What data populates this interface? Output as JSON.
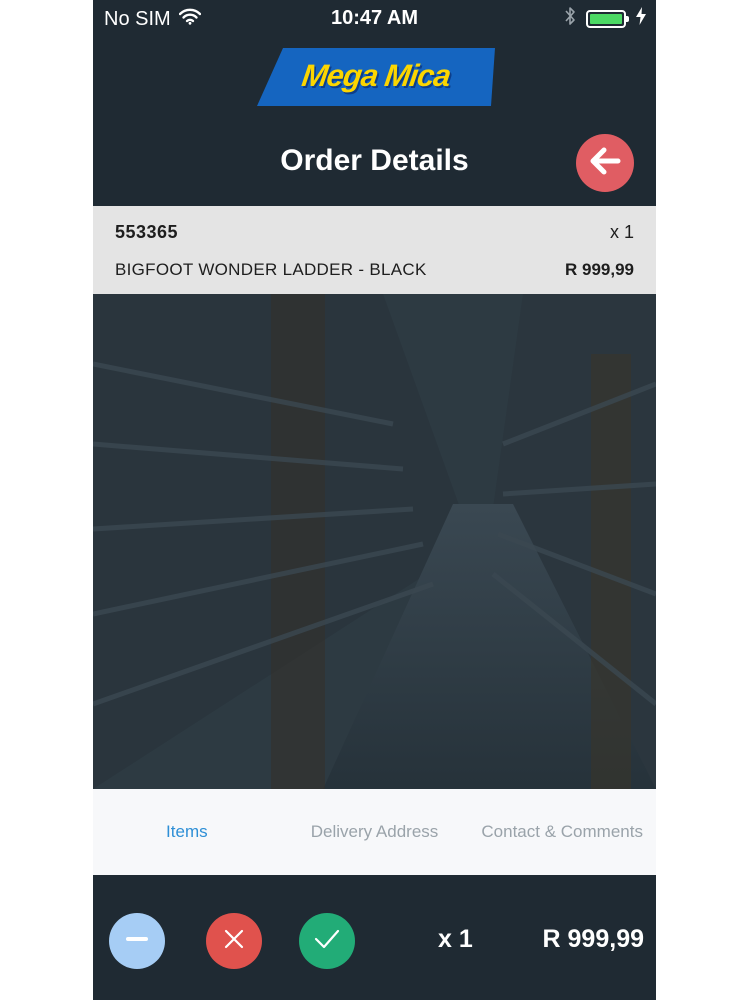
{
  "status_bar": {
    "carrier": "No SIM",
    "time": "10:47 AM",
    "icons": [
      "wifi-icon",
      "bluetooth-icon",
      "battery-icon",
      "charging-icon"
    ]
  },
  "header": {
    "logo_text": "Mega Mica",
    "title": "Order Details",
    "back_icon": "arrow-left-icon"
  },
  "item": {
    "code": "553365",
    "quantity": "x 1",
    "name": "BIGFOOT WONDER LADDER - BLACK",
    "price": "R 999,99"
  },
  "tabs": [
    {
      "label": "Items",
      "active": true
    },
    {
      "label": "Delivery Address",
      "active": false
    },
    {
      "label": "Contact & Comments",
      "active": false
    }
  ],
  "footer": {
    "actions": [
      "minus-icon",
      "close-icon",
      "check-icon"
    ],
    "quantity": "x 1",
    "total": "R 999,99"
  },
  "colors": {
    "background": "#1f2a33",
    "back_button": "#e05d63",
    "minus_button": "#a6cdf5",
    "cancel_button": "#e0524d",
    "confirm_button": "#22ac77",
    "active_tab": "#2e8fd6",
    "logo_blue": "#1565c0",
    "logo_yellow": "#fcd600"
  }
}
